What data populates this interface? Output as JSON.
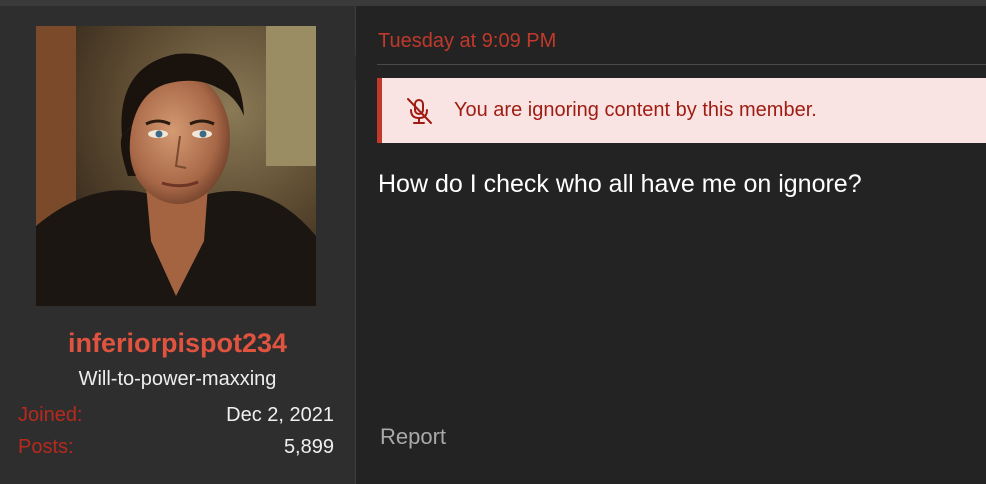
{
  "user": {
    "name": "inferiorpispot234",
    "title": "Will-to-power-maxxing",
    "joined_label": "Joined:",
    "joined_value": "Dec 2, 2021",
    "posts_label": "Posts:",
    "posts_value": "5,899"
  },
  "post": {
    "date": "Tuesday at 9:09 PM",
    "ignored_notice": "You are ignoring content by this member.",
    "ignored_icon": "muted-microphone-icon",
    "message": "How do I check who all have me on ignore?",
    "report_label": "Report"
  },
  "colors": {
    "accent_red": "#c0392b",
    "username_red": "#e0533f",
    "notice_bg": "#f9e3e3",
    "notice_text": "#9e1c12"
  }
}
